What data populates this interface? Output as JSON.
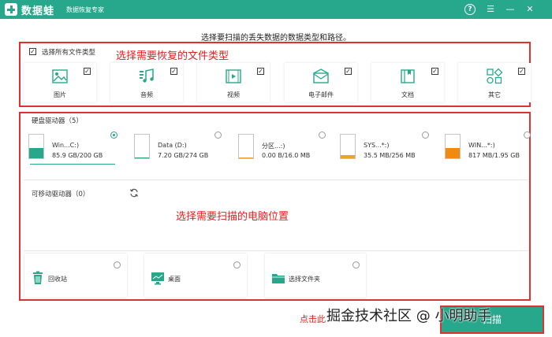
{
  "titlebar": {
    "app_name": "数据蛙",
    "subtitle": "数据恢复专家",
    "help_icon": "?",
    "menu_icon": "☰",
    "minimize_icon": "—",
    "close_icon": "✕",
    "color": "#27a88c"
  },
  "hint": "选择要扫描的丢失数据的数据类型和路径。",
  "file_types": {
    "select_all_label": "选择所有文件类型",
    "select_all_checked": true,
    "annotation": "选择需要恢复的文件类型",
    "items": [
      {
        "label": "图片",
        "icon": "image-icon",
        "checked": true
      },
      {
        "label": "音频",
        "icon": "music-icon",
        "checked": true
      },
      {
        "label": "视频",
        "icon": "video-icon",
        "checked": true
      },
      {
        "label": "电子邮件",
        "icon": "mail-icon",
        "checked": true
      },
      {
        "label": "文档",
        "icon": "document-icon",
        "checked": true
      },
      {
        "label": "其它",
        "icon": "other-icon",
        "checked": true
      }
    ]
  },
  "hard_disks": {
    "title": "硬盘驱动器（5）",
    "drives": [
      {
        "name": "Win...C:)",
        "size": "85.9 GB/200 GB",
        "selected": true,
        "usage": 0.43,
        "fill_color": "#27a88c"
      },
      {
        "name": "Data (D:)",
        "size": "7.20 GB/274 GB",
        "selected": false,
        "usage": 0.03,
        "fill_color": "#27a88c"
      },
      {
        "name": "分区...:)",
        "size": "0.00  B/16.0 MB",
        "selected": false,
        "usage": 0.02,
        "fill_color": "#f0a030"
      },
      {
        "name": "SYS...*:)",
        "size": "35.5 MB/256 MB",
        "selected": false,
        "usage": 0.14,
        "fill_color": "#f0a030"
      },
      {
        "name": "WIN...*:)",
        "size": "817 MB/1.95 GB",
        "selected": false,
        "usage": 0.42,
        "fill_color": "#f08a10"
      }
    ]
  },
  "removable": {
    "title": "可移动驱动器（0）",
    "refresh_icon": "refresh-icon"
  },
  "location_annotation": "选择需要扫描的电脑位置",
  "locations": [
    {
      "label": "回收站",
      "icon": "recycle-bin-icon"
    },
    {
      "label": "桌面",
      "icon": "desktop-icon"
    },
    {
      "label": "选择文件夹",
      "icon": "folder-icon"
    }
  ],
  "footer": {
    "click_hint": "点击此",
    "start_label": "扫描",
    "watermark": "掘金技术社区 @ 小明助手"
  }
}
